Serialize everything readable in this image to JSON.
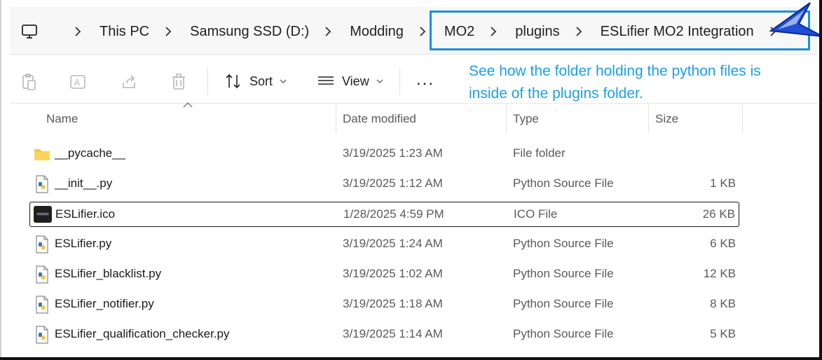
{
  "breadcrumb": {
    "items": [
      "This PC",
      "Samsung SSD (D:)",
      "Modding",
      "MO2",
      "plugins",
      "ESLifier MO2 Integration"
    ]
  },
  "toolbar": {
    "sort_label": "Sort",
    "view_label": "View",
    "more_label": "..."
  },
  "annotation": {
    "line1": "See how the folder holding the python files is",
    "line2": "inside of the plugins folder.",
    "color": "#1ea0e0",
    "box_color": "#1a8fd6"
  },
  "columns": {
    "name": "Name",
    "date": "Date modified",
    "type": "Type",
    "size": "Size"
  },
  "files": [
    {
      "name": "__pycache__",
      "date": "3/19/2025 1:23 AM",
      "type": "File folder",
      "size": "",
      "icon": "folder-icon"
    },
    {
      "name": "__init__.py",
      "date": "3/19/2025 1:12 AM",
      "type": "Python Source File",
      "size": "1 KB",
      "icon": "python-file-icon"
    },
    {
      "name": "ESLifier.ico",
      "date": "1/28/2025 4:59 PM",
      "type": "ICO File",
      "size": "26 KB",
      "icon": "ico-file-icon"
    },
    {
      "name": "ESLifier.py",
      "date": "3/19/2025 1:24 AM",
      "type": "Python Source File",
      "size": "6 KB",
      "icon": "python-file-icon"
    },
    {
      "name": "ESLifier_blacklist.py",
      "date": "3/19/2025 1:02 AM",
      "type": "Python Source File",
      "size": "12 KB",
      "icon": "python-file-icon"
    },
    {
      "name": "ESLifier_notifier.py",
      "date": "3/19/2025 1:18 AM",
      "type": "Python Source File",
      "size": "8 KB",
      "icon": "python-file-icon"
    },
    {
      "name": "ESLifier_qualification_checker.py",
      "date": "3/19/2025 1:14 AM",
      "type": "Python Source File",
      "size": "5 KB",
      "icon": "python-file-icon"
    }
  ]
}
